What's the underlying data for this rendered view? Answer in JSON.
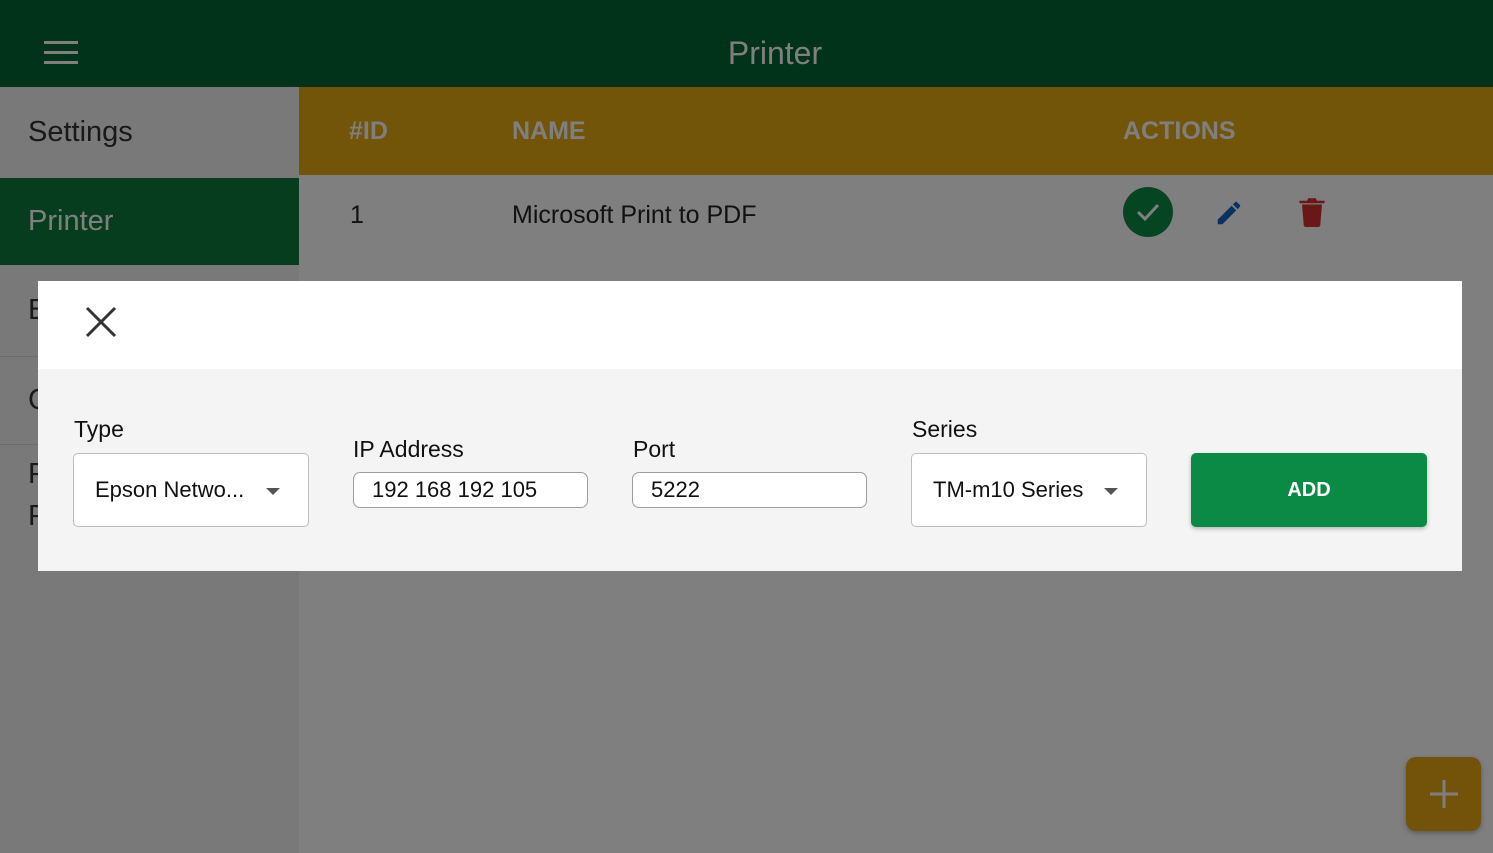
{
  "app": {
    "title": "Printer",
    "menu_icon": "hamburger-menu-icon"
  },
  "sidebar": {
    "items": [
      {
        "label": "Settings",
        "active": false
      },
      {
        "label": "Printer",
        "active": true
      },
      {
        "label": "B",
        "active": false
      },
      {
        "label": "C",
        "active": false
      },
      {
        "label": "P",
        "active": false
      },
      {
        "label": "P",
        "active": false
      }
    ]
  },
  "table": {
    "headers": {
      "id": "#ID",
      "name": "NAME",
      "actions": "ACTIONS"
    },
    "rows": [
      {
        "id": "1",
        "name": "Microsoft Print to PDF"
      }
    ],
    "action_icons": [
      "check-circle-icon",
      "pencil-edit-icon",
      "trash-delete-icon"
    ]
  },
  "modal": {
    "close_icon": "close-x-icon",
    "type_label": "Type",
    "type_value": "Epson Netwo...",
    "ip_label": "IP Address",
    "ip_value": "192 168 192 105",
    "port_label": "Port",
    "port_value": "5222",
    "series_label": "Series",
    "series_value": "TM-m10 Series",
    "add_label": "ADD"
  },
  "fab": {
    "icon": "plus-icon"
  },
  "colors": {
    "header_green": "#006633",
    "active_green": "#0b7a3c",
    "table_header_gold": "#e6aa14",
    "button_green": "#0b8a45",
    "edit_blue": "#1565c0",
    "delete_red": "#d32f2f"
  }
}
